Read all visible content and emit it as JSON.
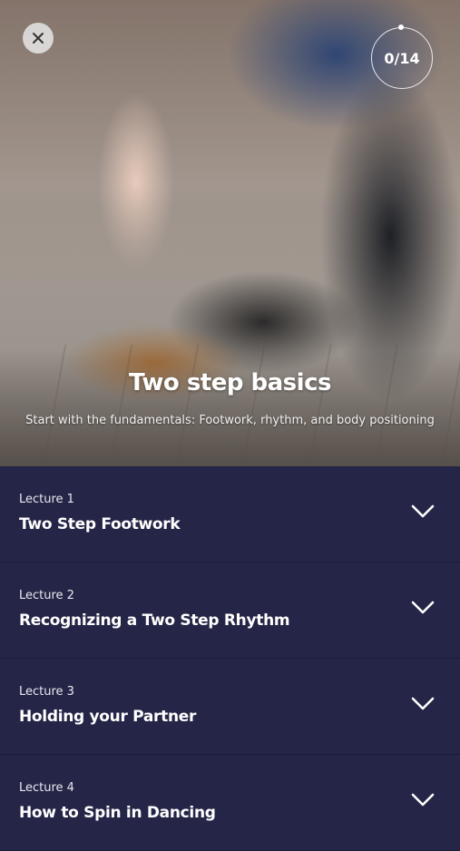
{
  "header": {
    "close_icon": "close-icon",
    "progress_text": "0/14"
  },
  "course": {
    "title": "Two step basics",
    "subtitle": "Start with the fundamentals: Footwork, rhythm, and body positioning"
  },
  "lectures": [
    {
      "number": "Lecture 1",
      "title": "Two Step Footwork",
      "icon": "chevron-down-icon"
    },
    {
      "number": "Lecture 2",
      "title": "Recognizing a Two Step Rhythm",
      "icon": "chevron-down-icon"
    },
    {
      "number": "Lecture 3",
      "title": "Holding your Partner",
      "icon": "chevron-down-icon"
    },
    {
      "number": "Lecture 4",
      "title": "How to Spin in Dancing",
      "icon": "chevron-down-icon"
    }
  ],
  "colors": {
    "list_background": "#252647",
    "text": "#ffffff"
  }
}
